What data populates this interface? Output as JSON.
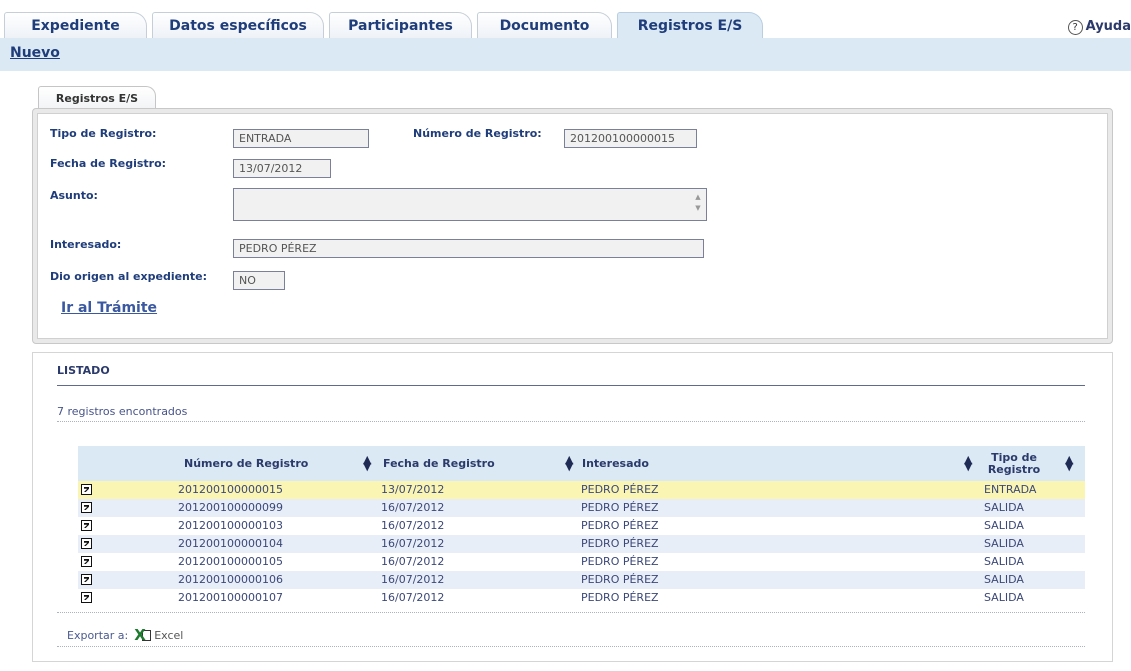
{
  "tabs": [
    {
      "label": "Expediente",
      "active": false
    },
    {
      "label": "Datos específicos",
      "active": false
    },
    {
      "label": "Participantes",
      "active": false
    },
    {
      "label": "Documento",
      "active": false
    },
    {
      "label": "Registros E/S",
      "active": true
    }
  ],
  "help_label": "Ayuda",
  "new_link": "Nuevo",
  "record": {
    "subtab": "Registros E/S",
    "tipo_label": "Tipo de Registro:",
    "tipo_value": "ENTRADA",
    "numero_label": "Número de Registro:",
    "numero_value": "201200100000015",
    "fecha_label": "Fecha de Registro:",
    "fecha_value": "13/07/2012",
    "asunto_label": "Asunto:",
    "asunto_value": "",
    "interesado_label": "Interesado:",
    "interesado_value": "PEDRO PÉREZ",
    "origen_label": "Dio origen al expediente:",
    "origen_value": "NO",
    "tramite_link": "Ir al Trámite"
  },
  "listado": {
    "title": "LISTADO",
    "count_text": "7 registros encontrados",
    "columns": [
      "Número de Registro",
      "Fecha de Registro",
      "Interesado",
      "Tipo de Registro"
    ],
    "rows": [
      {
        "numero": "201200100000015",
        "fecha": "13/07/2012",
        "interesado": "PEDRO PÉREZ",
        "tipo": "ENTRADA",
        "selected": true
      },
      {
        "numero": "201200100000099",
        "fecha": "16/07/2012",
        "interesado": "PEDRO PÉREZ",
        "tipo": "SALIDA"
      },
      {
        "numero": "201200100000103",
        "fecha": "16/07/2012",
        "interesado": "PEDRO PÉREZ",
        "tipo": "SALIDA"
      },
      {
        "numero": "201200100000104",
        "fecha": "16/07/2012",
        "interesado": "PEDRO PÉREZ",
        "tipo": "SALIDA"
      },
      {
        "numero": "201200100000105",
        "fecha": "16/07/2012",
        "interesado": "PEDRO PÉREZ",
        "tipo": "SALIDA"
      },
      {
        "numero": "201200100000106",
        "fecha": "16/07/2012",
        "interesado": "PEDRO PÉREZ",
        "tipo": "SALIDA"
      },
      {
        "numero": "201200100000107",
        "fecha": "16/07/2012",
        "interesado": "PEDRO PÉREZ",
        "tipo": "SALIDA"
      }
    ],
    "export_label": "Exportar a:",
    "excel_label": "Excel"
  },
  "colors": {
    "accent": "#1f3d7a",
    "header_bg": "#dbe9f5",
    "selected_row": "#fbf5b3",
    "alt_row": "#e7eef8"
  }
}
